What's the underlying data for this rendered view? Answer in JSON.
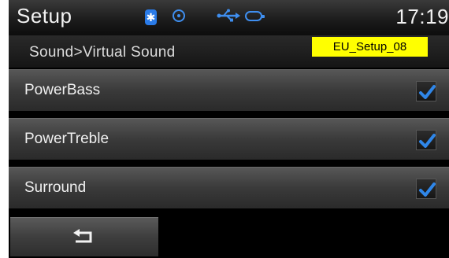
{
  "status_bar": {
    "title": "Setup",
    "clock": "17:19",
    "icons": [
      "bluetooth-icon",
      "disc-icon",
      "usb-icon",
      "ipod-icon"
    ],
    "bluetooth_glyph": "✱"
  },
  "breadcrumb": "Sound>Virtual Sound",
  "screen_tag": "EU_Setup_08",
  "items": [
    {
      "label": "PowerBass",
      "checked": true
    },
    {
      "label": "PowerTreble",
      "checked": true
    },
    {
      "label": "Surround",
      "checked": true
    }
  ],
  "back_button": {
    "icon": "back-arrow-icon"
  },
  "colors": {
    "accent": "#3f8ff0",
    "checkmark": "#2f86e8",
    "tag_background": "#ffff00"
  }
}
